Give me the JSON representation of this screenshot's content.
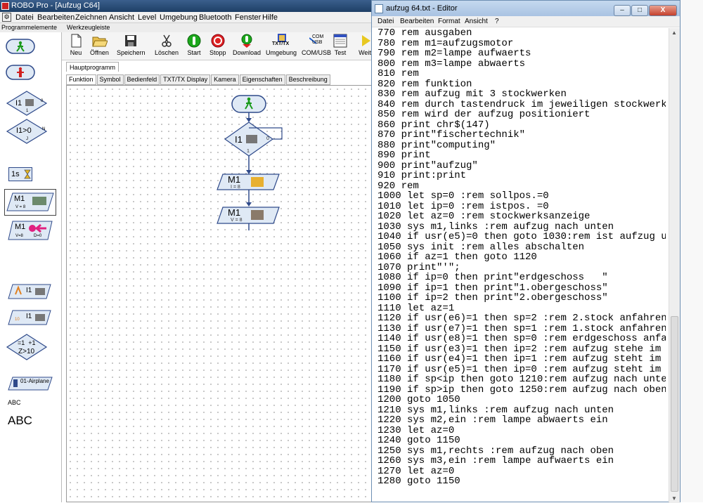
{
  "robo": {
    "title": "ROBO Pro - [Aufzug C64]",
    "menu": [
      "Datei",
      "Bearbeiten",
      "Zeichnen",
      "Ansicht",
      "Level",
      "Umgebung",
      "Bluetooth",
      "Fenster",
      "Hilfe"
    ],
    "section_labels": {
      "palette": "Programmelemente",
      "toolbar": "Werkzeugleiste"
    },
    "toolbar": [
      "Neu",
      "Öffnen",
      "Speichern",
      "Löschen",
      "Start",
      "Stopp",
      "Download",
      "Umgebung",
      "COM/USB",
      "Test",
      "Weit"
    ],
    "toolbar_icon_labels": {
      "txttx": "TXT/TX",
      "comusb": "COM\nUSB"
    },
    "program_tab": "Hauptprogramm",
    "subtabs": [
      "Funktion",
      "Symbol",
      "Bedienfeld",
      "TXT/TX Display",
      "Kamera",
      "Eigenschaften",
      "Beschreibung"
    ],
    "palette": {
      "i1": "I1",
      "i1_small": "0",
      "i1_small2": "1",
      "cmp": "I1>0",
      "cmp_j": "J",
      "cmp_n": "N",
      "wait": "1s",
      "m1": "M1",
      "m1_v": "V = 8",
      "m1b": "M1",
      "m1b_v": "V=8",
      "m1b_d": "D=0",
      "i1c": "I1",
      "i1d": "I1",
      "i1d_num": "10",
      "counter": "=1  +1",
      "counter2": "Z>10",
      "airplane": "01-Airplane",
      "abc_small": "ABC",
      "abc_big": "ABC"
    },
    "flow": {
      "i1": "I1",
      "i1_0": "0",
      "i1_1": "1",
      "m1a": "M1",
      "m1a_v": "I = 8",
      "m1b": "M1",
      "m1b_v": "V = 8"
    }
  },
  "editor": {
    "title": "aufzug 64.txt - Editor",
    "buttons": {
      "min": "–",
      "max": "□",
      "close": "X"
    },
    "menu": [
      "Datei",
      "Bearbeiten",
      "Format",
      "Ansicht",
      "?"
    ],
    "lines": [
      "770 rem ausgaben",
      "780 rem m1=aufzugsmotor",
      "790 rem m2=lampe aufwaerts",
      "800 rem m3=lampe abwaerts",
      "810 rem",
      "820 rem funktion",
      "830 rem aufzug mit 3 stockwerken",
      "840 rem durch tastendruck im jeweiligen stockwerk",
      "850 rem wird der aufzug positioniert",
      "860 print chr$(147)",
      "870 print\"fischertechnik\"",
      "880 print\"computing\"",
      "890 print",
      "900 print\"aufzug\"",
      "910 print:print",
      "920 rem",
      "1000 let sp=0 :rem sollpos.=0",
      "1010 let ip=0 :rem istpos. =0",
      "1020 let az=0 :rem stockwerksanzeige",
      "1030 sys m1,links :rem aufzug nach unten",
      "1040 if usr(e5)=0 then goto 1030:rem ist aufzug u",
      "1050 sys init :rem alles abschalten",
      "1060 if az=1 then goto 1120",
      "1070 print\"'\";",
      "1080 if ip=0 then print\"erdgeschoss   \"",
      "1090 if ip=1 then print\"1.obergeschoss\"",
      "1100 if ip=2 then print\"2.obergeschoss\"",
      "1110 let az=1",
      "1120 if usr(e6)=1 then sp=2 :rem 2.stock anfahren",
      "1130 if usr(e7)=1 then sp=1 :rem 1.stock anfahren",
      "1140 if usr(e8)=1 then sp=0 :rem erdgeschoss anfa",
      "1150 if usr(e3)=1 then ip=2 :rem aufzug stehe im",
      "1160 if usr(e4)=1 then ip=1 :rem aufzug steht im",
      "1170 if usr(e5)=1 then ip=0 :rem aufzug steht im",
      "1180 if sp<ip then goto 1210:rem aufzug nach unte",
      "1190 if sp>ip then goto 1250:rem aufzug nach oben",
      "1200 goto 1050",
      "1210 sys m1,links :rem aufzug nach unten",
      "1220 sys m2,ein :rem lampe abwaerts ein",
      "1230 let az=0",
      "1240 goto 1150",
      "1250 sys m1,rechts :rem aufzug nach oben",
      "1260 sys m3,ein :rem lampe aufwaerts ein",
      "1270 let az=0",
      "1280 goto 1150"
    ]
  }
}
